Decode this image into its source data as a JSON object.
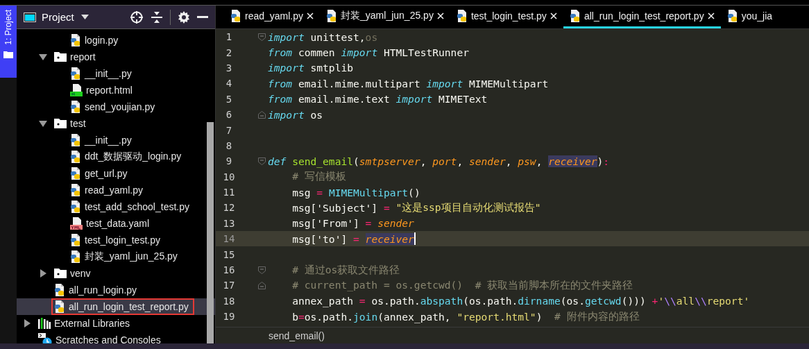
{
  "tool_stripe": {
    "label": "1: Project",
    "selected": true
  },
  "project_panel": {
    "title": "Project",
    "tree": [
      {
        "children": [
          {
            "children": [
              {
                "name": "login.py",
                "kind": "python",
                "selected": false
              }
            ]
          },
          {
            "name": "report",
            "kind": "folder",
            "expanded": true,
            "selected": false,
            "children": [
              {
                "name": "__init__.py",
                "kind": "python",
                "selected": false
              },
              {
                "name": "report.html",
                "kind": "html",
                "selected": false
              },
              {
                "name": "send_youjian.py",
                "kind": "python",
                "selected": false
              }
            ]
          },
          {
            "name": "test",
            "kind": "folder",
            "expanded": true,
            "selected": false,
            "children": [
              {
                "name": "__init__.py",
                "kind": "python",
                "selected": false
              },
              {
                "name": "ddt_数据驱动_login.py",
                "kind": "python",
                "selected": false
              },
              {
                "name": "get_url.py",
                "kind": "python",
                "selected": false
              },
              {
                "name": "read_yaml.py",
                "kind": "python",
                "selected": false
              },
              {
                "name": "test_add_school_test.py",
                "kind": "python",
                "selected": false
              },
              {
                "name": "test_data.yaml",
                "kind": "yaml",
                "selected": false
              },
              {
                "name": "test_login_test.py",
                "kind": "python",
                "selected": false
              },
              {
                "name": "封装_yaml_jun_25.py",
                "kind": "python",
                "selected": false
              }
            ]
          },
          {
            "name": "venv",
            "kind": "folder",
            "expanded": false,
            "selected": false
          },
          {
            "name": "all_run_login.py",
            "kind": "python",
            "selected": false
          },
          {
            "name": "all_run_login_test_report.py",
            "kind": "python",
            "selected": true
          }
        ]
      },
      {
        "name": "External Libraries",
        "kind": "libraries",
        "expanded": false,
        "selected": false
      },
      {
        "name": "Scratches and Consoles",
        "kind": "scratches",
        "selected": false
      }
    ]
  },
  "editor": {
    "tabs": [
      {
        "label": "read_yaml.py",
        "selected": false,
        "close_button": true
      },
      {
        "label": "封装_yaml_jun_25.py",
        "selected": false,
        "close_button": true
      },
      {
        "label": "test_login_test.py",
        "selected": false,
        "close_button": true
      },
      {
        "label": "all_run_login_test_report.py",
        "selected": true,
        "close_button": true
      },
      {
        "label": "you_jia",
        "selected": false,
        "close_button": false
      }
    ],
    "lines": [
      {
        "number": "1",
        "fold_start": true,
        "fold_end": false,
        "current": false,
        "tokens": [
          {
            "t": "import",
            "kind": "kw"
          },
          {
            "t": " unittest,",
            "kind": "plain"
          },
          {
            "t": "os",
            "kind": "dim"
          }
        ]
      },
      {
        "number": "2",
        "fold_start": false,
        "fold_end": false,
        "current": false,
        "tokens": [
          {
            "t": "from",
            "kind": "kw"
          },
          {
            "t": " commen ",
            "kind": "plain"
          },
          {
            "t": "import",
            "kind": "kw"
          },
          {
            "t": " HTMLTestRunner",
            "kind": "plain"
          }
        ]
      },
      {
        "number": "3",
        "fold_start": false,
        "fold_end": false,
        "current": false,
        "tokens": [
          {
            "t": "import",
            "kind": "kw"
          },
          {
            "t": " smtplib",
            "kind": "plain"
          }
        ]
      },
      {
        "number": "4",
        "fold_start": false,
        "fold_end": false,
        "current": false,
        "tokens": [
          {
            "t": "from",
            "kind": "kw"
          },
          {
            "t": " email.mime.multipart ",
            "kind": "plain"
          },
          {
            "t": "import",
            "kind": "kw"
          },
          {
            "t": " MIMEMultipart",
            "kind": "plain"
          }
        ]
      },
      {
        "number": "5",
        "fold_start": false,
        "fold_end": false,
        "current": false,
        "tokens": [
          {
            "t": "from",
            "kind": "kw"
          },
          {
            "t": " email.mime.text ",
            "kind": "plain"
          },
          {
            "t": "import",
            "kind": "kw"
          },
          {
            "t": " MIMEText",
            "kind": "plain"
          }
        ]
      },
      {
        "number": "6",
        "fold_start": false,
        "fold_end": true,
        "current": false,
        "tokens": [
          {
            "t": "import",
            "kind": "kw"
          },
          {
            "t": " os",
            "kind": "plain"
          }
        ]
      },
      {
        "number": "7",
        "fold_start": false,
        "fold_end": false,
        "current": false
      },
      {
        "number": "8",
        "fold_start": false,
        "fold_end": false,
        "current": false
      },
      {
        "number": "9",
        "fold_start": true,
        "fold_end": false,
        "current": false,
        "tokens": [
          {
            "t": "def",
            "kind": "kw"
          },
          {
            "t": " send_email",
            "kind": "fn"
          },
          {
            "t": "(",
            "kind": "plain"
          },
          {
            "t": "smtpserver",
            "kind": "param"
          },
          {
            "t": ", ",
            "kind": "plain"
          },
          {
            "t": "port",
            "kind": "param"
          },
          {
            "t": ", ",
            "kind": "plain"
          },
          {
            "t": "sender",
            "kind": "param"
          },
          {
            "t": ", ",
            "kind": "plain"
          },
          {
            "t": "psw",
            "kind": "param"
          },
          {
            "t": ", ",
            "kind": "plain"
          },
          {
            "t": "receiver",
            "kind": "param_ref"
          },
          {
            "t": ")",
            "kind": "plain"
          },
          {
            "t": ":",
            "kind": "op"
          }
        ]
      },
      {
        "number": "10",
        "fold_start": false,
        "fold_end": false,
        "current": false,
        "tokens": [
          {
            "t": "    # 写信模板",
            "kind": "comment"
          }
        ]
      },
      {
        "number": "11",
        "fold_start": false,
        "fold_end": false,
        "current": false,
        "tokens": [
          {
            "t": "    msg ",
            "kind": "plain"
          },
          {
            "t": "= ",
            "kind": "op"
          },
          {
            "t": "MIMEMultipart",
            "kind": "builtin"
          },
          {
            "t": "()",
            "kind": "plain"
          }
        ]
      },
      {
        "number": "12",
        "fold_start": false,
        "fold_end": false,
        "current": false,
        "tokens": [
          {
            "t": "    msg['Subject'] ",
            "kind": "plain"
          },
          {
            "t": "= ",
            "kind": "op"
          },
          {
            "t": "\"这是ssp项目自动化测试报告\"",
            "kind": "str"
          }
        ]
      },
      {
        "number": "13",
        "fold_start": false,
        "fold_end": false,
        "current": false,
        "tokens": [
          {
            "t": "    msg['From'] ",
            "kind": "plain"
          },
          {
            "t": "= ",
            "kind": "op"
          },
          {
            "t": "sender",
            "kind": "param"
          }
        ]
      },
      {
        "number": "14",
        "fold_start": false,
        "fold_end": false,
        "current": true,
        "tokens": [
          {
            "t": "    msg['to'] ",
            "kind": "plain"
          },
          {
            "t": "= ",
            "kind": "op"
          },
          {
            "t": "receiver",
            "kind": "param_ref"
          }
        ]
      },
      {
        "number": "15",
        "fold_start": false,
        "fold_end": false,
        "current": false
      },
      {
        "number": "16",
        "fold_start": true,
        "fold_end": false,
        "current": false,
        "tokens": [
          {
            "t": "    # 通过os获取文件路径",
            "kind": "comment"
          }
        ]
      },
      {
        "number": "17",
        "fold_start": false,
        "fold_end": true,
        "current": false,
        "tokens": [
          {
            "t": "    # current_path = os.getcwd()  # 获取当前脚本所在的文件夹路径",
            "kind": "comment"
          }
        ]
      },
      {
        "number": "18",
        "fold_start": false,
        "fold_end": false,
        "current": false,
        "tokens": [
          {
            "t": "    annex_path ",
            "kind": "plain"
          },
          {
            "t": "=",
            "kind": "op"
          },
          {
            "t": " os.path.",
            "kind": "plain"
          },
          {
            "t": "abspath",
            "kind": "builtin"
          },
          {
            "t": "(os.path.",
            "kind": "plain"
          },
          {
            "t": "dirname",
            "kind": "builtin"
          },
          {
            "t": "(os.",
            "kind": "plain"
          },
          {
            "t": "getcwd",
            "kind": "builtin"
          },
          {
            "t": "())) ",
            "kind": "plain"
          },
          {
            "t": "+",
            "kind": "op"
          },
          {
            "t": "'",
            "kind": "str"
          },
          {
            "t": "\\\\",
            "kind": "escape"
          },
          {
            "t": "all",
            "kind": "str"
          },
          {
            "t": "\\\\",
            "kind": "escape"
          },
          {
            "t": "report'",
            "kind": "str"
          }
        ]
      },
      {
        "number": "19",
        "fold_start": false,
        "fold_end": false,
        "current": false,
        "tokens": [
          {
            "t": "    b",
            "kind": "plain"
          },
          {
            "t": "=",
            "kind": "op"
          },
          {
            "t": "os.path.",
            "kind": "plain"
          },
          {
            "t": "join",
            "kind": "builtin"
          },
          {
            "t": "(annex_path, ",
            "kind": "plain"
          },
          {
            "t": "\"report.html\"",
            "kind": "str"
          },
          {
            "t": ")  ",
            "kind": "plain"
          },
          {
            "t": "# 附件内容的路径",
            "kind": "comment"
          }
        ]
      }
    ],
    "breadcrumb": "send_email()"
  }
}
